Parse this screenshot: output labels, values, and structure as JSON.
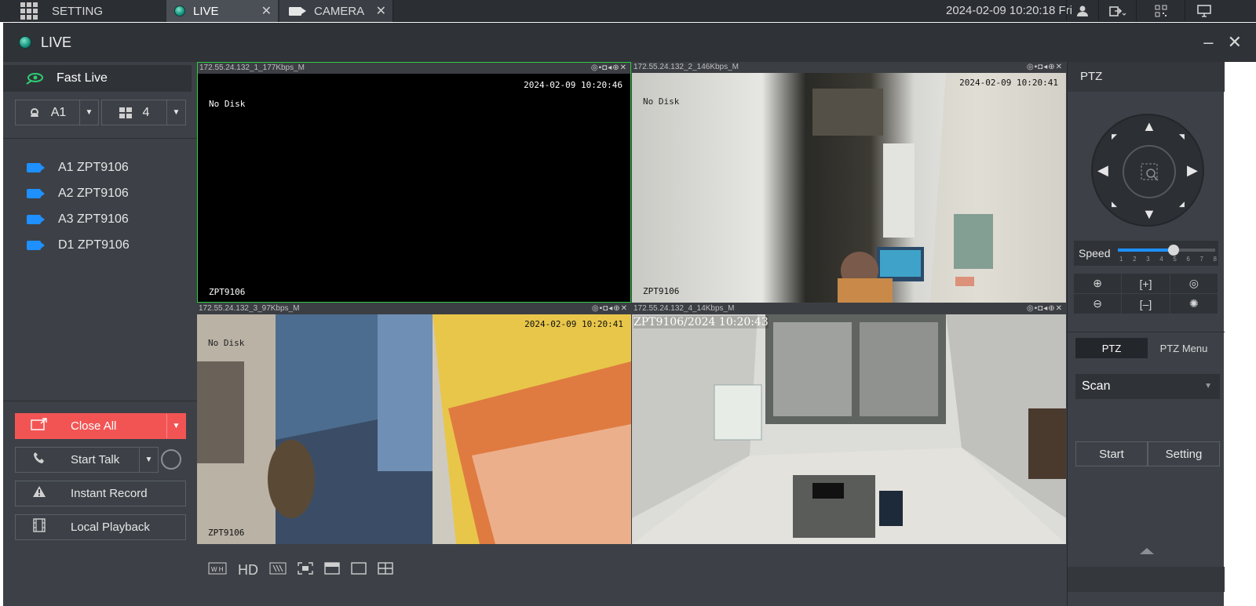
{
  "topbar": {
    "tabs": [
      {
        "label": "SETTING",
        "icon": "grid-icon"
      },
      {
        "label": "LIVE",
        "icon": "live-dot-icon"
      },
      {
        "label": "CAMERA",
        "icon": "camera-icon"
      }
    ],
    "close_glyph": "✕",
    "datetime": "2024-02-09 10:20:18 Fri"
  },
  "header": {
    "title": "LIVE",
    "controls": "– ✕"
  },
  "left": {
    "fast_live": "Fast Live",
    "group_selector": "A1",
    "split_selector": "4",
    "channels": [
      "A1 ZPT9106",
      "A2 ZPT9106",
      "A3 ZPT9106",
      "D1 ZPT9106"
    ],
    "buttons": {
      "close_all": "Close All",
      "start_talk": "Start Talk",
      "instant_record": "Instant Record",
      "local_playback": "Local Playback"
    }
  },
  "video": {
    "cells": [
      {
        "bar": "172.55.24.132_1_177Kbps_M",
        "timestamp": "2024-02-09 10:20:46",
        "disk": "No Disk",
        "name": "ZPT9106"
      },
      {
        "bar": "172.55.24.132_2_146Kbps_M",
        "timestamp": "2024-02-09 10:20:41",
        "disk": "No Disk",
        "name": "ZPT9106"
      },
      {
        "bar": "172.55.24.132_3_97Kbps_M",
        "timestamp": "2024-02-09 10:20:41",
        "disk": "No Disk",
        "name": "ZPT9106"
      },
      {
        "bar": "172.55.24.132_4_14Kbps_M",
        "timestamp": "ZPT9106/2024 10:20:43",
        "disk": "",
        "name": ""
      }
    ],
    "cell_controls": "◎▪◘◂⊕✕",
    "toolbar_hd": "HD"
  },
  "ptz": {
    "title": "PTZ",
    "speed_label": "Speed",
    "speed_value": 5,
    "speed_ticks": [
      "1",
      "2",
      "3",
      "4",
      "5",
      "6",
      "7",
      "8"
    ],
    "tab_ptz": "PTZ",
    "tab_menu": "PTZ Menu",
    "mode": "Scan",
    "start": "Start",
    "setting": "Setting"
  },
  "colors": {
    "accent_blue": "#1e90ff",
    "close_all_red": "#f25454",
    "selected_border": "#2ecc40"
  }
}
